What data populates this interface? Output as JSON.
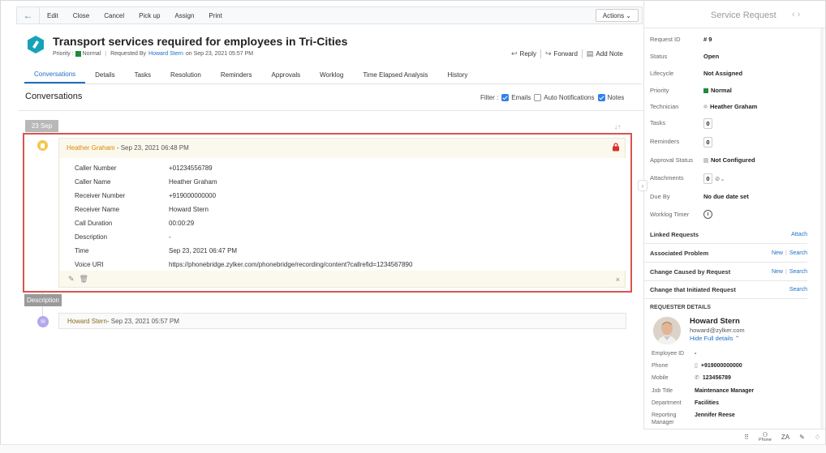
{
  "toolbar": {
    "back_icon": "←",
    "buttons": [
      "Edit",
      "Close",
      "Cancel",
      "Pick up",
      "Assign",
      "Print"
    ],
    "actions_label": "Actions ⌄"
  },
  "header": {
    "title": "Transport services required for employees in Tri-Cities",
    "priority_label": "Priority :",
    "priority_value": "Normal",
    "requested_by_label": "Requested By",
    "requested_by": "Howard Stern",
    "requested_on": "on Sep 23, 2021 05:57 PM",
    "reply": "Reply",
    "forward": "Forward",
    "add_note": "Add Note",
    "reply_icon": "↩",
    "forward_icon": "↪",
    "note_icon": "▤"
  },
  "tabs": [
    "Conversations",
    "Details",
    "Tasks",
    "Resolution",
    "Reminders",
    "Approvals",
    "Worklog",
    "Time Elapsed Analysis",
    "History"
  ],
  "conversations": {
    "title": "Conversations",
    "filter_label": "Filter :",
    "filters": [
      {
        "label": "Emails",
        "checked": true
      },
      {
        "label": "Auto Notifications",
        "checked": false
      },
      {
        "label": "Notes",
        "checked": true
      }
    ],
    "date_group": "23 Sep",
    "sort_icon": "↓↑",
    "card": {
      "author": "Heather Graham",
      "timestamp": "- Sep 23, 2021 06:48 PM",
      "fields": [
        {
          "k": "Caller Number",
          "v": "+01234556789"
        },
        {
          "k": "Caller Name",
          "v": "Heather Graham"
        },
        {
          "k": "Receiver Number",
          "v": "+919000000000"
        },
        {
          "k": "Receiver Name",
          "v": "Howard Stern"
        },
        {
          "k": "Call Duration",
          "v": "00:00:29"
        },
        {
          "k": "Description",
          "v": "-"
        },
        {
          "k": "Time",
          "v": "Sep 23, 2021 06:47 PM"
        },
        {
          "k": "Voice URI",
          "v": "https://phonebridge.zylker.com/phonebridge/recording/content?callrefid=1234567890"
        }
      ],
      "edit_icon": "✎",
      "delete_icon": "🗑",
      "close_icon": "×"
    },
    "description_pill": "Description",
    "entry2_author": "Howard Stern",
    "entry2_timestamp": "- Sep 23, 2021 05:57 PM"
  },
  "right_panel": {
    "title": "Service Request",
    "nav": "‹ ›",
    "collapse_icon": "›",
    "props": [
      {
        "k": "Request ID",
        "v": "# 9"
      },
      {
        "k": "Status",
        "v": "Open"
      },
      {
        "k": "Lifecycle",
        "v": "Not Assigned"
      },
      {
        "k": "Priority",
        "v": "Normal"
      },
      {
        "k": "Technician",
        "v": "Heather Graham"
      },
      {
        "k": "Tasks",
        "v": "0"
      },
      {
        "k": "Reminders",
        "v": "0"
      },
      {
        "k": "Approval Status",
        "v": "Not Configured"
      },
      {
        "k": "Attachments",
        "v": "0"
      },
      {
        "k": "Due By",
        "v": "No due date set"
      },
      {
        "k": "Worklog Timer",
        "v": ""
      }
    ],
    "links": [
      {
        "label": "Linked Requests",
        "actions": [
          "Attach"
        ]
      },
      {
        "label": "Associated Problem",
        "actions": [
          "New",
          "Search"
        ]
      },
      {
        "label": "Change Caused by Request",
        "actions": [
          "New",
          "Search"
        ]
      },
      {
        "label": "Change that Initiated Request",
        "actions": [
          "Search"
        ]
      }
    ],
    "requester_header": "REQUESTER DETAILS",
    "requester_name": "Howard Stern",
    "requester_email": "howard@zylker.com",
    "hide_details": "Hide Full details ⌃",
    "details": [
      {
        "k": "Employee ID",
        "v": "-"
      },
      {
        "k": "Phone",
        "v": "+919000000000"
      },
      {
        "k": "Mobile",
        "v": "123456789"
      },
      {
        "k": "Job Title",
        "v": "Maintenance Manager"
      },
      {
        "k": "Department",
        "v": "Facilities"
      },
      {
        "k": "Reporting",
        "v": "Jennifer Reese"
      },
      {
        "k": "Manager",
        "v": ""
      }
    ],
    "phone_icon": "▯",
    "mobile_icon": "✆",
    "attach_icon": "⊘⌄"
  },
  "bottom_bar": {
    "grid_icon": "⠿",
    "phone_label": "Phone",
    "sort_label": "ZA",
    "edit_icon": "✎",
    "bulb_icon": "♢"
  },
  "colors": {
    "accent": "#1f6fc7",
    "highlight_border": "#d9534f",
    "priority_green": "#1f8a3b"
  }
}
